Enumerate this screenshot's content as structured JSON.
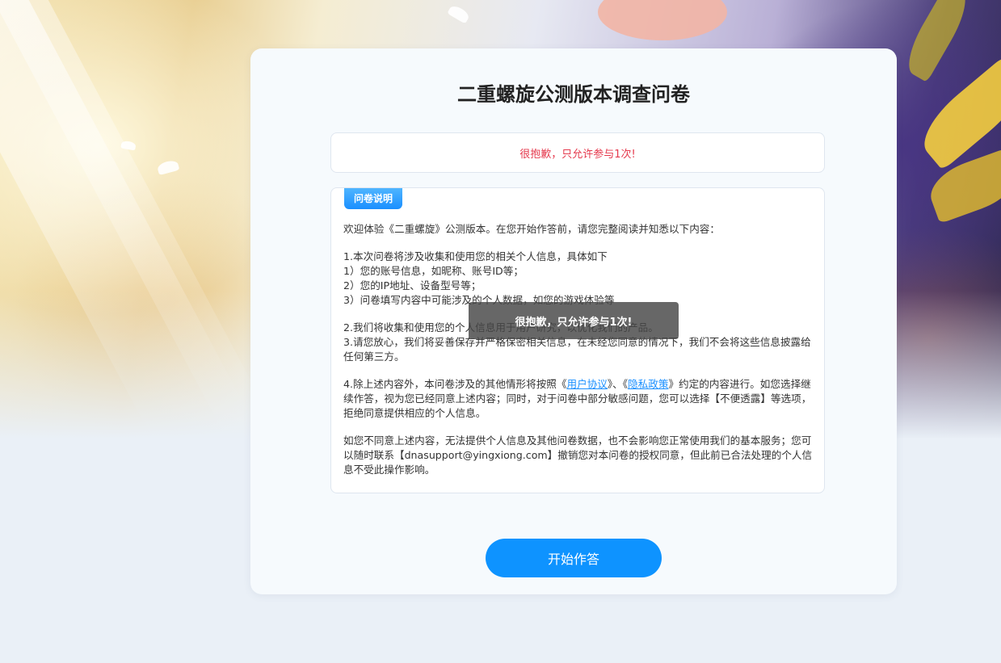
{
  "survey": {
    "title": "二重螺旋公测版本调查问卷",
    "error_message": "很抱歉，只允许参与1次!",
    "notice_tag": "问卷说明",
    "intro": "欢迎体验《二重螺旋》公测版本。在您开始作答前，请您完整阅读并知悉以下内容：",
    "section1": {
      "heading": "1.本次问卷将涉及收集和使用您的相关个人信息，具体如下",
      "item1": "1）您的账号信息，如昵称、账号ID等；",
      "item2": "2）您的IP地址、设备型号等；",
      "item3": "3）问卷填写内容中可能涉及的个人数据，如您的游戏体验等"
    },
    "section2": {
      "line1": "2.我们将收集和使用您的个人信息用于用户研究，以优化我们的产品。",
      "line2": "3.请您放心，我们将妥善保存并严格保密相关信息，在未经您同意的情况下，我们不会将这些信息披露给任何第三方。"
    },
    "section4": {
      "prefix": "4.除上述内容外，本问卷涉及的其他情形将按照《",
      "user_agreement": "用户协议",
      "middle": "》、《",
      "privacy_policy": "隐私政策",
      "suffix": "》约定的内容进行。如您选择继续作答，视为您已经同意上述内容；同时，对于问卷中部分敏感问题，您可以选择【不便透露】等选项，拒绝同意提供相应的个人信息。"
    },
    "closing": "如您不同意上述内容，无法提供个人信息及其他问卷数据，也不会影响您正常使用我们的基本服务；您可以随时联系【dnasupport@yingxiong.com】撤销您对本问卷的授权同意，但此前已合法处理的个人信息不受此操作影响。",
    "start_button": "开始作答"
  },
  "toast": {
    "message": "很抱歉，只允许参与1次!"
  },
  "colors": {
    "accent": "#0e93ff",
    "error": "#e5394d",
    "page_bg": "#eaf0f7"
  }
}
